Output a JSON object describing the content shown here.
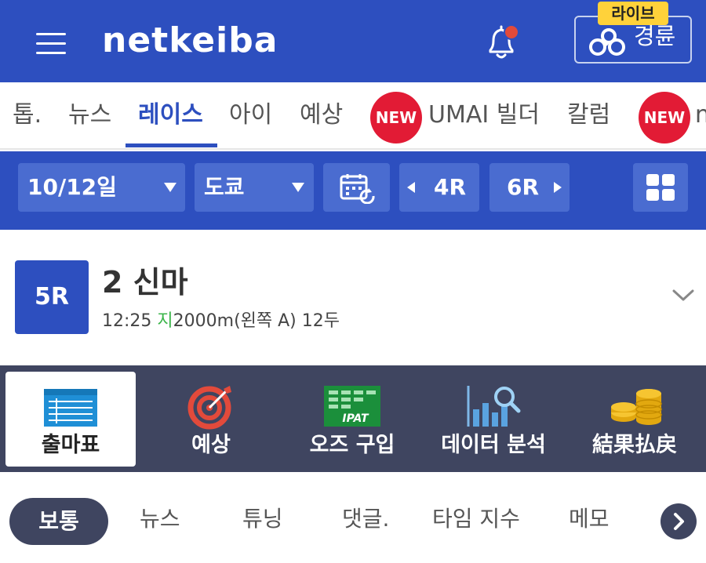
{
  "header": {
    "logo": "netkeiba",
    "live_badge": "라이브",
    "keirin_label": "경륜",
    "colors": {
      "brand": "#2d4fbf",
      "notify_dot": "#e24a3b",
      "live_badge": "#ffd23a"
    }
  },
  "nav": {
    "tabs": [
      {
        "label": "톱."
      },
      {
        "label": "뉴스"
      },
      {
        "label": "레이스",
        "active": true
      },
      {
        "label": "아이"
      },
      {
        "label": "예상"
      },
      {
        "label": "UMAI 빌더",
        "badge": "NEW"
      },
      {
        "label": "칼럼"
      },
      {
        "label": "n",
        "badge": "NEW"
      }
    ]
  },
  "selector": {
    "date": "10/12일",
    "venue": "도쿄",
    "prev_race": "4R",
    "next_race": "6R"
  },
  "race": {
    "number": "5R",
    "title": "2 신마",
    "time": "12:25",
    "surface": "지",
    "details": "2000m(왼쪽 A) 12두",
    "surface_color": "#3bb54a"
  },
  "menu": {
    "items": [
      {
        "label": "출마표",
        "icon": "entry-table-icon",
        "active": true
      },
      {
        "label": "예상",
        "icon": "target-icon"
      },
      {
        "label": "오즈 구입",
        "icon": "ipat-icon"
      },
      {
        "label": "데이터 분석",
        "icon": "chart-search-icon"
      },
      {
        "label": "結果払戻",
        "icon": "coins-icon"
      }
    ]
  },
  "subtabs": {
    "items": [
      {
        "label": "보통",
        "active": true
      },
      {
        "label": "뉴스"
      },
      {
        "label": "튜닝"
      },
      {
        "label": "댓글."
      },
      {
        "label": "타임 지수"
      },
      {
        "label": "메모"
      }
    ]
  }
}
